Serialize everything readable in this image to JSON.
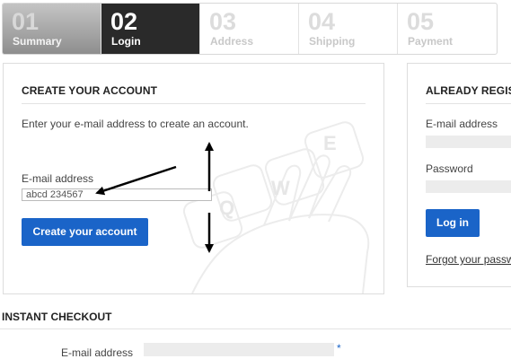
{
  "steps": [
    {
      "num": "01",
      "label": "Summary"
    },
    {
      "num": "02",
      "label": "Login"
    },
    {
      "num": "03",
      "label": "Address"
    },
    {
      "num": "04",
      "label": "Shipping"
    },
    {
      "num": "05",
      "label": "Payment"
    }
  ],
  "create": {
    "title": "CREATE YOUR ACCOUNT",
    "intro": "Enter your e-mail address to create an account.",
    "email_label": "E-mail address",
    "email_value": "abcd 234567",
    "button": "Create your account"
  },
  "already": {
    "title": "ALREADY REGIST",
    "email_label": "E-mail address",
    "password_label": "Password",
    "button": "Log in",
    "forgot": "Forgot your passw"
  },
  "instant": {
    "title": "INSTANT CHECKOUT",
    "email_label": "E-mail address",
    "required_mark": "*"
  },
  "keyboard_keys": [
    "Q",
    "W",
    "E"
  ],
  "colors": {
    "accent": "#1a64c8",
    "active_step": "#2a2a2a"
  }
}
